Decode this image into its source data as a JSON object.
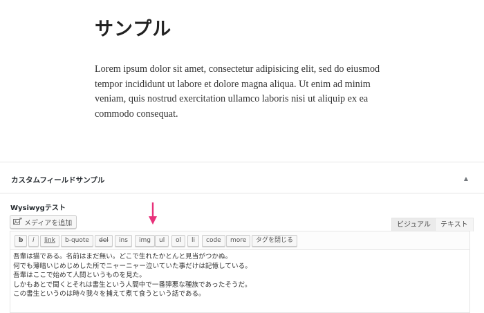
{
  "post": {
    "title": "サンプル",
    "body": "Lorem ipsum dolor sit amet, consectetur adipisicing elit, sed do eiusmod tempor incididunt ut labore et dolore magna aliqua. Ut enim ad minim veniam, quis nostrud exercitation ullamco laboris nisi ut aliquip ex ea commodo consequat."
  },
  "metabox": {
    "title": "カスタムフィールドサンプル",
    "toggle_icon": "triangle-up-icon",
    "field_label": "Wysiwygテスト",
    "media_button": "メディアを追加",
    "tabs": {
      "visual": "ビジュアル",
      "text": "テキスト"
    },
    "active_tab": "テキスト",
    "quicktags": {
      "b": "b",
      "i": "i",
      "link": "link",
      "bquote": "b-quote",
      "del": "del",
      "ins": "ins",
      "img": "img",
      "ul": "ul",
      "ol": "ol",
      "li": "li",
      "code": "code",
      "more": "more",
      "close": "タグを閉じる"
    },
    "content_lines": [
      "吾輩は猫である。名前はまだ無い。どこで生れたかとんと見当がつかぬ。",
      "何でも薄暗いじめじめした所でニャーニャー泣いていた事だけは記憶している。",
      "吾輩はここで始めて人間というものを見た。",
      "しかもあとで聞くとそれは書生という人間中で一番獰悪な種族であったそうだ。",
      "この書生というのは時々我々を捕えて煮て食うという話である。"
    ]
  },
  "colors": {
    "annotation_arrow": "#e8317a",
    "border": "#e5e5e5",
    "button_bg": "#f7f7f7"
  }
}
